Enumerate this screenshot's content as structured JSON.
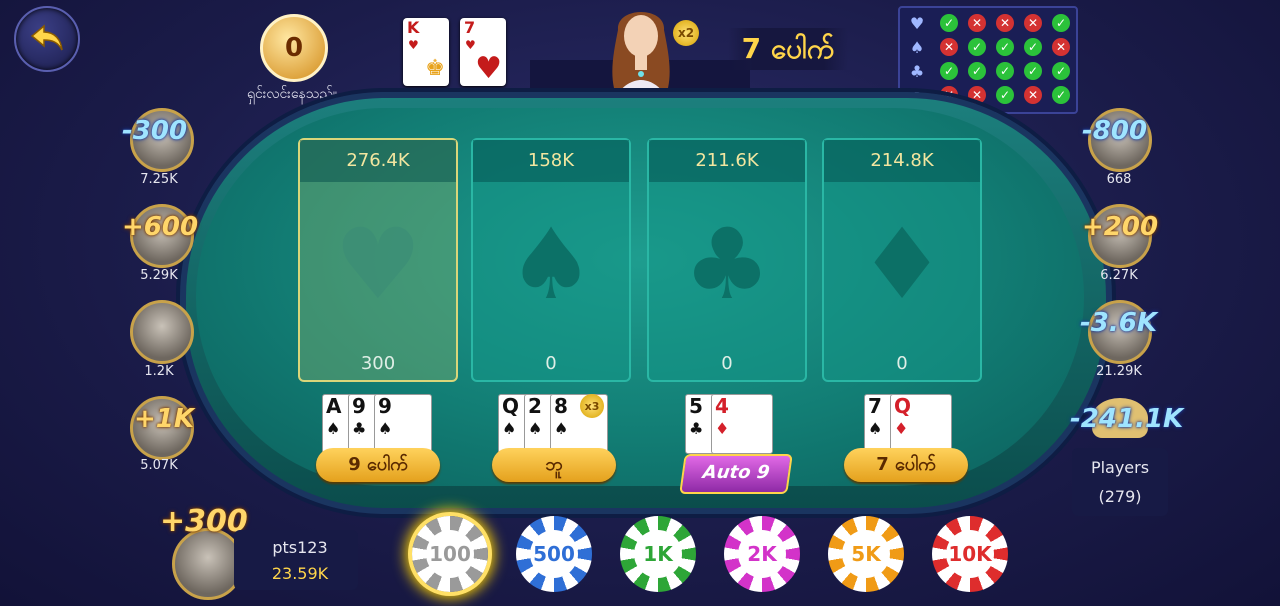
{
  "header": {
    "timer_value": "0",
    "timer_label": "ရှင်းလင်းနေသည်။",
    "banker_cards": [
      {
        "rank": "K",
        "suit": "♥"
      },
      {
        "rank": "7",
        "suit": "♥"
      }
    ],
    "dealer_multiplier": "x2",
    "result_label": "7 ပေါက်"
  },
  "history": {
    "rows": [
      {
        "suit": "♥",
        "cells": [
          "w",
          "l",
          "l",
          "l",
          "w"
        ]
      },
      {
        "suit": "♠",
        "cells": [
          "l",
          "w",
          "w",
          "w",
          "l"
        ]
      },
      {
        "suit": "♣",
        "cells": [
          "w",
          "w",
          "w",
          "w",
          "w"
        ]
      },
      {
        "suit": "♦",
        "cells": [
          "l",
          "l",
          "w",
          "l",
          "w"
        ]
      }
    ]
  },
  "bet_areas": [
    {
      "suit": "♥",
      "total": "276.4K",
      "mine": "300"
    },
    {
      "suit": "♠",
      "total": "158K",
      "mine": "0"
    },
    {
      "suit": "♣",
      "total": "211.6K",
      "mine": "0"
    },
    {
      "suit": "♦",
      "total": "214.8K",
      "mine": "0"
    }
  ],
  "hands": [
    {
      "label": "9 ပေါက်",
      "cards": [
        {
          "rank": "A",
          "suit": "♠"
        },
        {
          "rank": "9",
          "suit": "♣"
        },
        {
          "rank": "9",
          "suit": "♠"
        }
      ]
    },
    {
      "label": "ဘူ",
      "cards": [
        {
          "rank": "Q",
          "suit": "♠"
        },
        {
          "rank": "2",
          "suit": "♠"
        },
        {
          "rank": "8",
          "suit": "♠"
        }
      ],
      "multiplier": "x3"
    },
    {
      "label": "Auto 9",
      "cards": [
        {
          "rank": "5",
          "suit": "♣"
        },
        {
          "rank": "4",
          "suit": "♦"
        }
      ]
    },
    {
      "label": "7 ပေါက်",
      "cards": [
        {
          "rank": "7",
          "suit": "♠"
        },
        {
          "rank": "Q",
          "suit": "♦"
        }
      ]
    }
  ],
  "players_left": [
    {
      "delta": "-300",
      "score": "7.25K"
    },
    {
      "delta": "+600",
      "score": "5.29K"
    },
    {
      "delta": "",
      "score": "1.2K"
    },
    {
      "delta": "+1K",
      "score": "5.07K"
    }
  ],
  "players_right": [
    {
      "delta": "-800",
      "score": "668"
    },
    {
      "delta": "+200",
      "score": "6.27K"
    },
    {
      "delta": "-3.6K",
      "score": "21.29K"
    },
    {
      "delta": "-241.1K",
      "score": ""
    }
  ],
  "me": {
    "delta": "+300",
    "name": "pts123",
    "score": "23.59K"
  },
  "players_button": {
    "label": "Players",
    "count": "(279)"
  },
  "chips": [
    {
      "label": "100",
      "color": "#9a9a9a"
    },
    {
      "label": "500",
      "color": "#2f6fd6"
    },
    {
      "label": "1K",
      "color": "#2ea637"
    },
    {
      "label": "2K",
      "color": "#d333c9"
    },
    {
      "label": "5K",
      "color": "#f09b16"
    },
    {
      "label": "10K",
      "color": "#de2d2d"
    }
  ],
  "colors": {
    "gold": "#ffd54a",
    "felt": "#127d74",
    "background": "#1b1c4a"
  }
}
